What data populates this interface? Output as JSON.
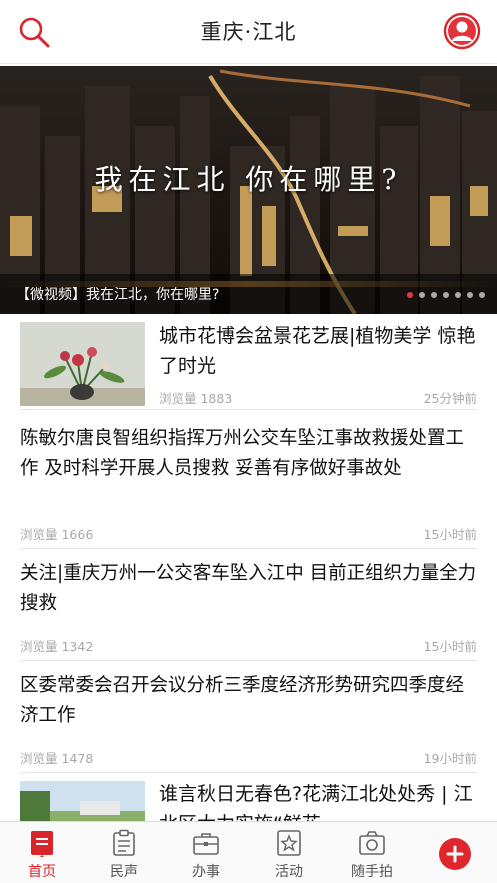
{
  "header": {
    "title": "重庆·江北",
    "search_icon": "search-icon",
    "avatar_icon": "user-avatar-icon",
    "accent_color": "#d8262d"
  },
  "banner": {
    "overlay_text": "我在江北  你在哪里?",
    "caption": "【微视频】我在江北，你在哪里?",
    "slides_count": 7,
    "active_slide": 1
  },
  "news": [
    {
      "headline": "城市花博会盆景花艺展|植物美学 惊艳了时光",
      "views": "浏览量 1883",
      "time": "25分钟前",
      "has_thumb": true
    },
    {
      "headline": "陈敏尔唐良智组织指挥万州公交车坠江事故救援处置工作 及时科学开展人员搜救 妥善有序做好事故处",
      "views": "浏览量 1666",
      "time": "15小时前",
      "has_thumb": false
    },
    {
      "headline": "关注|重庆万州一公交客车坠入江中 目前正组织力量全力搜救",
      "views": "浏览量 1342",
      "time": "15小时前",
      "has_thumb": false
    },
    {
      "headline": "区委常委会召开会议分析三季度经济形势研究四季度经济工作",
      "views": "浏览量 1478",
      "time": "19小时前",
      "has_thumb": false
    },
    {
      "headline": "谁言秋日无春色?花满江北处处秀 | 江北区大力实施“鲜花",
      "views": "",
      "time": "",
      "has_thumb": true
    }
  ],
  "tabbar": {
    "tabs": [
      {
        "label": "首页",
        "icon": "home-doc-icon",
        "active": true
      },
      {
        "label": "民声",
        "icon": "clipboard-icon",
        "active": false
      },
      {
        "label": "办事",
        "icon": "briefcase-icon",
        "active": false
      },
      {
        "label": "活动",
        "icon": "star-doc-icon",
        "active": false
      },
      {
        "label": "随手拍",
        "icon": "camera-icon",
        "active": false
      }
    ],
    "plus_icon": "plus-icon"
  }
}
